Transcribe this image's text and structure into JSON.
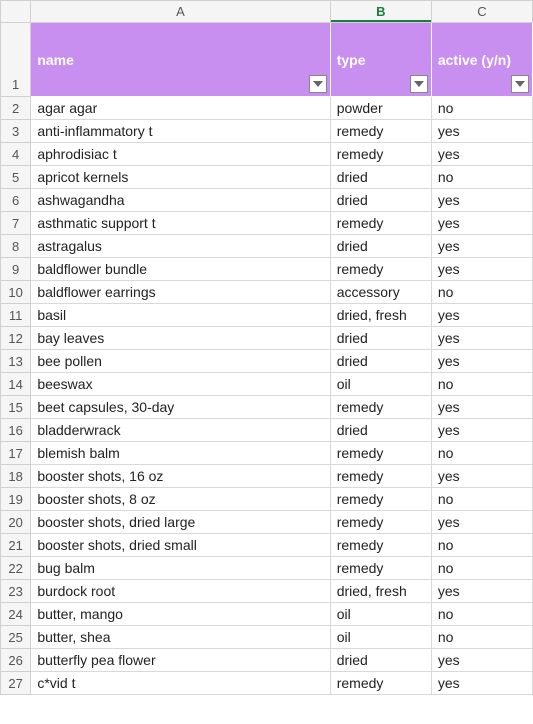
{
  "columns": {
    "letters": [
      "A",
      "B",
      "C"
    ],
    "selected_index": 1
  },
  "header": {
    "name": "name",
    "type": "type",
    "active": "active (y/n)"
  },
  "rows": [
    {
      "n": "2",
      "name": "agar agar",
      "type": "powder",
      "active": "no"
    },
    {
      "n": "3",
      "name": "anti-inflammatory t",
      "type": "remedy",
      "active": "yes"
    },
    {
      "n": "4",
      "name": "aphrodisiac t",
      "type": "remedy",
      "active": "yes"
    },
    {
      "n": "5",
      "name": "apricot kernels",
      "type": "dried",
      "active": "no"
    },
    {
      "n": "6",
      "name": "ashwagandha",
      "type": "dried",
      "active": "yes"
    },
    {
      "n": "7",
      "name": "asthmatic support t",
      "type": "remedy",
      "active": "yes"
    },
    {
      "n": "8",
      "name": "astragalus",
      "type": "dried",
      "active": "yes"
    },
    {
      "n": "9",
      "name": "baldflower bundle",
      "type": "remedy",
      "active": "yes"
    },
    {
      "n": "10",
      "name": "baldflower earrings",
      "type": "accessory",
      "active": "no"
    },
    {
      "n": "11",
      "name": "basil",
      "type": "dried, fresh",
      "active": "yes"
    },
    {
      "n": "12",
      "name": "bay leaves",
      "type": "dried",
      "active": "yes"
    },
    {
      "n": "13",
      "name": "bee pollen",
      "type": "dried",
      "active": "yes"
    },
    {
      "n": "14",
      "name": "beeswax",
      "type": "oil",
      "active": "no"
    },
    {
      "n": "15",
      "name": "beet capsules, 30-day",
      "type": "remedy",
      "active": "yes"
    },
    {
      "n": "16",
      "name": "bladderwrack",
      "type": "dried",
      "active": "yes"
    },
    {
      "n": "17",
      "name": "blemish balm",
      "type": "remedy",
      "active": "no"
    },
    {
      "n": "18",
      "name": "booster shots, 16 oz",
      "type": "remedy",
      "active": "yes"
    },
    {
      "n": "19",
      "name": "booster shots, 8 oz",
      "type": "remedy",
      "active": "no"
    },
    {
      "n": "20",
      "name": "booster shots, dried large",
      "type": "remedy",
      "active": "yes"
    },
    {
      "n": "21",
      "name": "booster shots, dried small",
      "type": "remedy",
      "active": "no"
    },
    {
      "n": "22",
      "name": "bug balm",
      "type": "remedy",
      "active": "no"
    },
    {
      "n": "23",
      "name": "burdock root",
      "type": "dried, fresh",
      "active": "yes"
    },
    {
      "n": "24",
      "name": "butter, mango",
      "type": "oil",
      "active": "no"
    },
    {
      "n": "25",
      "name": "butter, shea",
      "type": "oil",
      "active": "no"
    },
    {
      "n": "26",
      "name": "butterfly pea flower",
      "type": "dried",
      "active": "yes"
    },
    {
      "n": "27",
      "name": "c*vid t",
      "type": "remedy",
      "active": "yes"
    }
  ],
  "header_row_number": "1"
}
